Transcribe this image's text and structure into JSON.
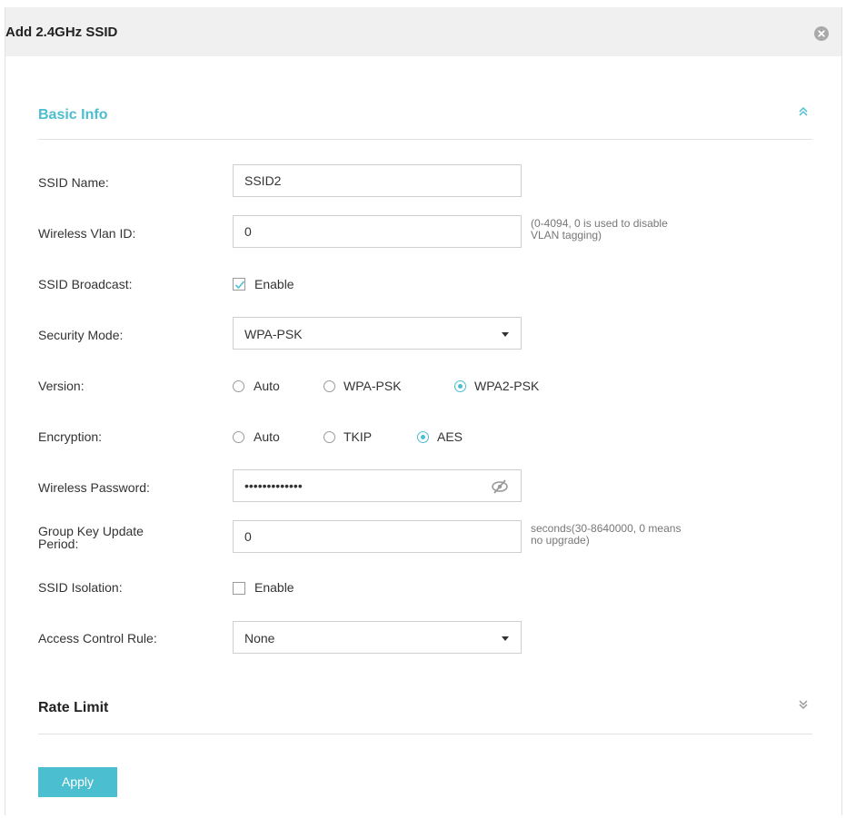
{
  "dialog": {
    "title": "Add 2.4GHz SSID"
  },
  "sections": {
    "basic_info": "Basic Info",
    "rate_limit": "Rate Limit"
  },
  "form": {
    "ssid_name": {
      "label": "SSID Name:",
      "value": "SSID2"
    },
    "vlan_id": {
      "label": "Wireless Vlan ID:",
      "value": "0",
      "hint_line1": "(0-4094, 0 is used to disable",
      "hint_line2": "VLAN tagging)"
    },
    "ssid_broadcast": {
      "label": "SSID Broadcast:",
      "option": "Enable",
      "checked": true
    },
    "security_mode": {
      "label": "Security Mode:",
      "value": "WPA-PSK"
    },
    "version": {
      "label": "Version:",
      "options": [
        "Auto",
        "WPA-PSK",
        "WPA2-PSK"
      ],
      "selected": "WPA2-PSK"
    },
    "encryption": {
      "label": "Encryption:",
      "options": [
        "Auto",
        "TKIP",
        "AES"
      ],
      "selected": "AES"
    },
    "wireless_password": {
      "label": "Wireless Password:",
      "value": "•••••••••••••"
    },
    "group_key": {
      "label_line1": "Group Key Update",
      "label_line2": "Period:",
      "value": "0",
      "hint_line1": "seconds(30-8640000, 0 means",
      "hint_line2": "no upgrade)"
    },
    "ssid_isolation": {
      "label": "SSID Isolation:",
      "option": "Enable",
      "checked": false
    },
    "access_control": {
      "label": "Access Control Rule:",
      "value": "None"
    }
  },
  "buttons": {
    "apply": "Apply"
  },
  "colors": {
    "accent": "#4bbecf",
    "header_bg": "#f0f0f0"
  },
  "icons": {
    "close": "close-circle-icon",
    "collapse": "chevron-double-up-icon",
    "expand": "chevron-double-down-icon",
    "password_visibility": "eye-slash-icon",
    "dropdown": "caret-down-icon"
  }
}
